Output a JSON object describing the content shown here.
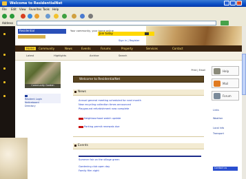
{
  "window": {
    "title": "Welcome to ResidentialNet",
    "icon": "ie-icon"
  },
  "menubar": {
    "items": [
      "File",
      "Edit",
      "View",
      "Favorites",
      "Tools",
      "Help"
    ]
  },
  "toolbar": {
    "buttons": [
      "back",
      "forward",
      "stop",
      "refresh",
      "home",
      "search",
      "favorites",
      "media",
      "history",
      "mail",
      "print"
    ]
  },
  "addressbar": {
    "label": "Address",
    "go_label": "Go"
  },
  "header": {
    "logo_text": "Residential",
    "tagline": "Your community, your home online",
    "banner_text": "Join today",
    "sub_text": "Sign in | Register"
  },
  "nav": {
    "items": [
      "Home",
      "Community",
      "News",
      "Events",
      "Forums",
      "Property",
      "Services",
      "Contact"
    ],
    "selected_index": 0
  },
  "subnav": {
    "items": [
      "Latest",
      "Highlights",
      "Archive",
      "Search"
    ]
  },
  "leftpane": {
    "photo_caption": "Community Garden",
    "links": [
      "Resident Login",
      "Noticeboard",
      "Directory"
    ]
  },
  "main": {
    "toplinks": "Print | Email",
    "title": "Welcome to ResidentialNet",
    "sections": [
      {
        "heading": "News",
        "lines": [
          "Annual general meeting scheduled for next month",
          "New recycling collection times announced",
          "Playground refurbishment now complete",
          "Neighbourhood watch update",
          "Parking permit renewals due"
        ]
      },
      {
        "heading": "Events",
        "lines": [
          "Summer fair on the village green",
          "Gardening club open day",
          "Family film night"
        ]
      }
    ]
  },
  "rightcol": {
    "buttons": [
      "Help",
      "Mail",
      "Forum"
    ],
    "links": [
      "Links",
      "Weather",
      "Local info",
      "Transport"
    ],
    "bottom_box": "Contact us"
  },
  "colors": {
    "nav_bg": "#3a2410",
    "nav_text": "#ffe070",
    "link": "#1a3ac8",
    "accent_red": "#c81010"
  }
}
